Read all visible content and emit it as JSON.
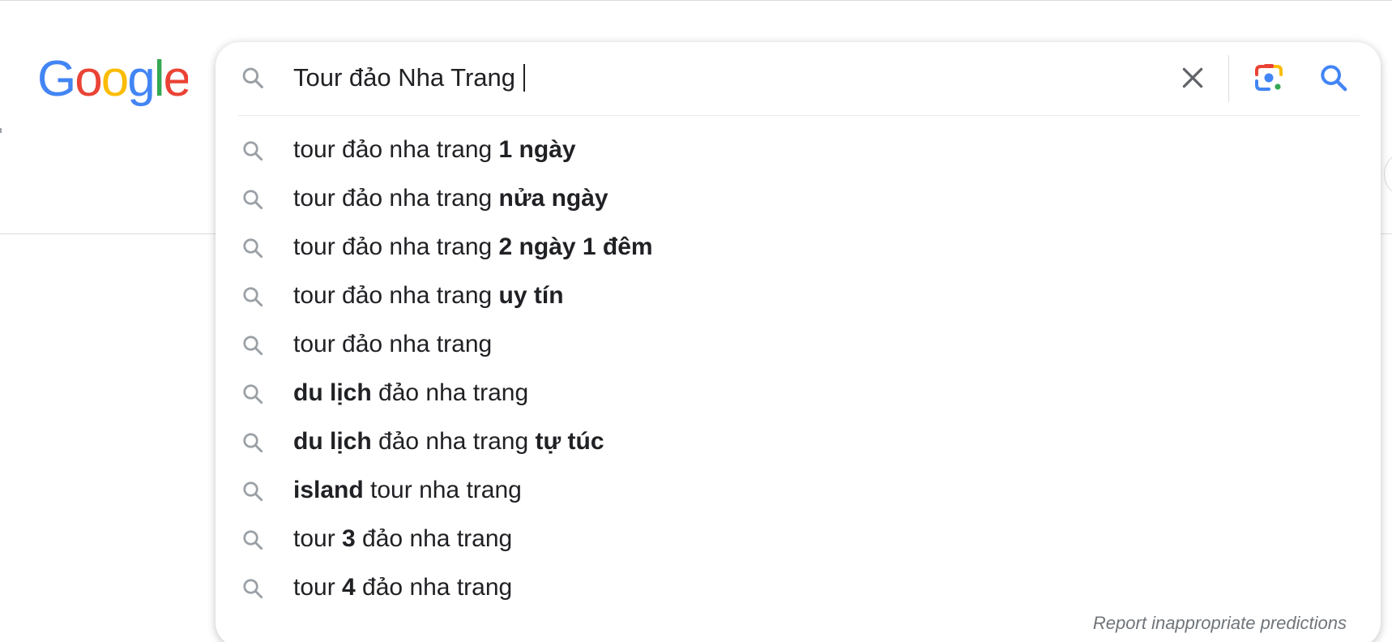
{
  "header": {
    "logo_text": "Google",
    "logo_colors": [
      "#4285F4",
      "#EA4335",
      "#FBBC05",
      "#4285F4",
      "#34A853",
      "#EA4335"
    ]
  },
  "search": {
    "query": "Tour đảo Nha Trang",
    "icons": {
      "leading": "search-icon",
      "clear": "close-icon",
      "lens": "camera-lens-icon",
      "submit": "search-icon"
    },
    "accent_color": "#4285F4"
  },
  "suggestions": [
    {
      "parts": [
        {
          "text": "tour đảo nha trang ",
          "bold": false
        },
        {
          "text": "1 ngày",
          "bold": true
        }
      ]
    },
    {
      "parts": [
        {
          "text": "tour đảo nha trang ",
          "bold": false
        },
        {
          "text": "nửa ngày",
          "bold": true
        }
      ]
    },
    {
      "parts": [
        {
          "text": "tour đảo nha trang ",
          "bold": false
        },
        {
          "text": "2 ngày 1 đêm",
          "bold": true
        }
      ]
    },
    {
      "parts": [
        {
          "text": "tour đảo nha trang ",
          "bold": false
        },
        {
          "text": "uy tín",
          "bold": true
        }
      ]
    },
    {
      "parts": [
        {
          "text": "tour đảo nha trang",
          "bold": false
        }
      ]
    },
    {
      "parts": [
        {
          "text": "du lịch",
          "bold": true
        },
        {
          "text": " đảo nha trang",
          "bold": false
        }
      ]
    },
    {
      "parts": [
        {
          "text": "du lịch",
          "bold": true
        },
        {
          "text": " đảo nha trang ",
          "bold": false
        },
        {
          "text": "tự túc",
          "bold": true
        }
      ]
    },
    {
      "parts": [
        {
          "text": "island",
          "bold": true
        },
        {
          "text": " tour nha trang",
          "bold": false
        }
      ]
    },
    {
      "parts": [
        {
          "text": "tour ",
          "bold": false
        },
        {
          "text": "3",
          "bold": true
        },
        {
          "text": " đảo nha trang",
          "bold": false
        }
      ]
    },
    {
      "parts": [
        {
          "text": "tour ",
          "bold": false
        },
        {
          "text": "4",
          "bold": true
        },
        {
          "text": " đảo nha trang",
          "bold": false
        }
      ]
    }
  ],
  "footer": {
    "report_label": "Report inappropriate predictions"
  }
}
